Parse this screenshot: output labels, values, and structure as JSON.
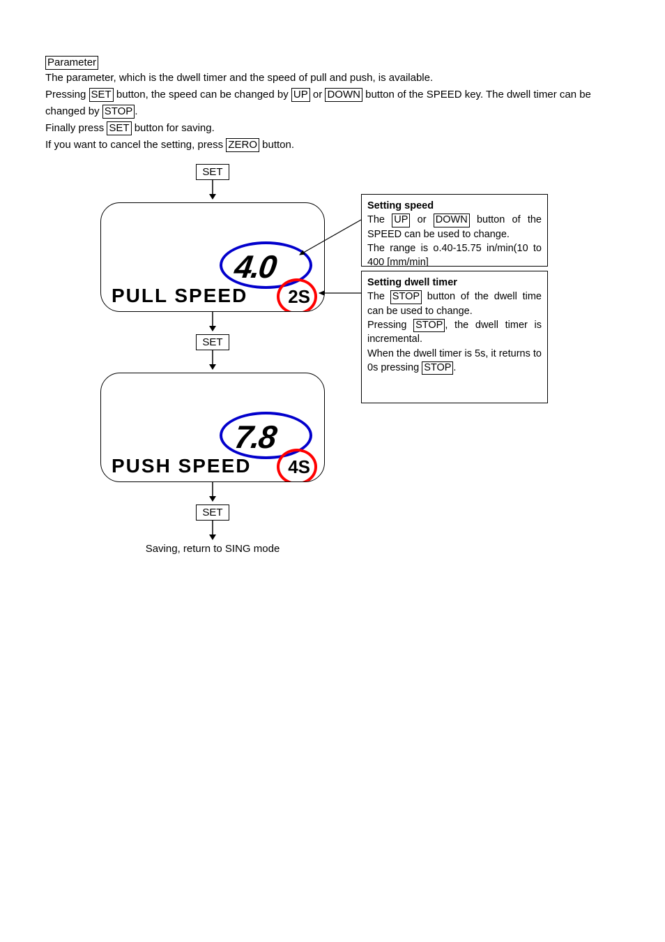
{
  "heading": "Parameter",
  "intro_line": "The parameter, which is the dwell timer and the speed of pull and push, is available.",
  "line2_a": "Pressing ",
  "line2_b": " button, the speed can be changed by ",
  "line2_c": " or ",
  "line2_d": " button of the SPEED key.    The dwell timer can be changed by ",
  "line2_e": ".",
  "line3_a": "Finally press ",
  "line3_b": " button for saving.",
  "line4_a": "If you want to cancel the setting, press ",
  "line4_b": " button.",
  "btn": {
    "set": "SET",
    "up": "UP",
    "down": "DOWN",
    "stop": "STOP",
    "zero": "ZERO"
  },
  "flow": {
    "set1": "SET",
    "set2": "SET",
    "set3": "SET",
    "footer": "Saving, return to SING mode"
  },
  "lcd1": {
    "speed": "4.0",
    "label": "PULL  SPEED",
    "dwell": "2S"
  },
  "lcd2": {
    "speed": "7.8",
    "label": "PUSH  SPEED",
    "dwell": "4S"
  },
  "side_speed": {
    "title": "Setting speed",
    "l1a": "The ",
    "l1b": " or ",
    "l1c": " button of the SPEED can be used to change.",
    "l2": "The range is o.40-15.75 in/min(10 to 400 [mm/min]"
  },
  "side_dwell": {
    "title": "Setting dwell timer",
    "l1a": "The ",
    "l1b": " button of the dwell time can be used to change.",
    "l2a": "Pressing ",
    "l2b": ", the dwell timer is incremental.",
    "l3a": "When the dwell timer is 5s, it returns to 0s pressing ",
    "l3b": "."
  }
}
